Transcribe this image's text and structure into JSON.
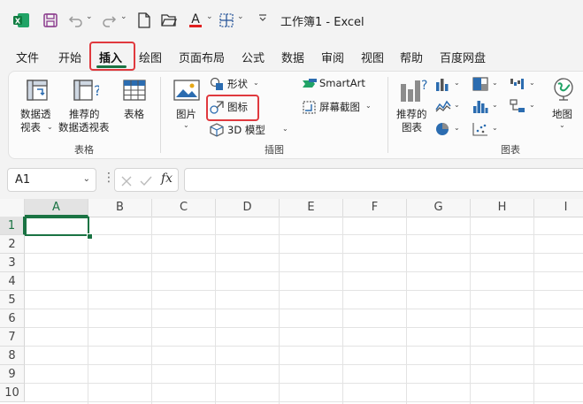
{
  "window": {
    "title": "工作簿1  -  Excel"
  },
  "tabs": [
    "文件",
    "开始",
    "插入",
    "绘图",
    "页面布局",
    "公式",
    "数据",
    "审阅",
    "视图",
    "帮助",
    "百度网盘"
  ],
  "ribbon": {
    "tables_group": {
      "label": "表格",
      "pivot_table_line1": "数据透",
      "pivot_table_line2": "视表",
      "recommended_pivot_line1": "推荐的",
      "recommended_pivot_line2": "数据透视表",
      "table": "表格"
    },
    "illustrations_group": {
      "label": "插图",
      "pictures": "图片",
      "shapes": "形状",
      "icons": "图标",
      "models_3d": "3D 模型",
      "smartart": "SmartArt",
      "screenshot": "屏幕截图"
    },
    "charts_group": {
      "label": "图表",
      "recommended_charts_line1": "推荐的",
      "recommended_charts_line2": "图表",
      "maps": "地图"
    }
  },
  "formula_bar": {
    "name_box": "A1",
    "fx": "fx",
    "formula": ""
  },
  "grid": {
    "columns": [
      "A",
      "B",
      "C",
      "D",
      "E",
      "F",
      "G",
      "H",
      "I"
    ],
    "rows": [
      "1",
      "2",
      "3",
      "4",
      "5",
      "6",
      "7",
      "8",
      "9",
      "10"
    ],
    "active_cell": "A1"
  },
  "colors": {
    "accent": "#1a7343",
    "highlight": "#e0393e"
  }
}
